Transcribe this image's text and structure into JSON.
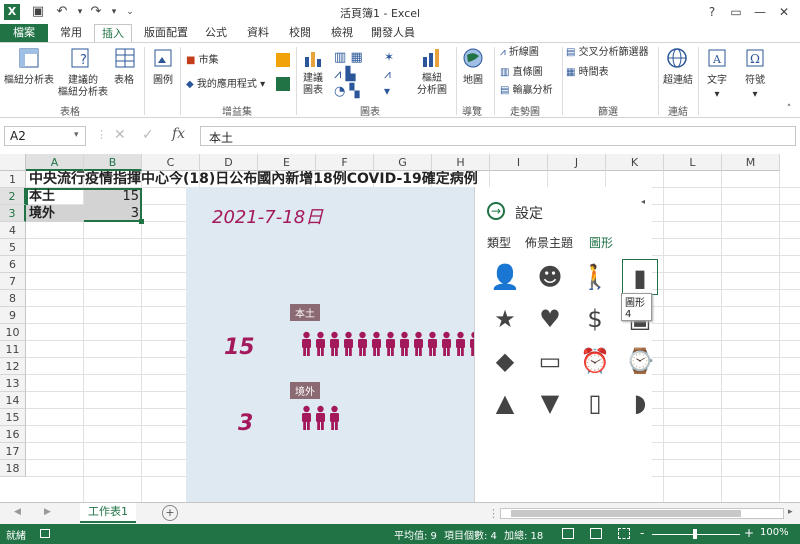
{
  "window": {
    "title": "活頁簿1 - Excel",
    "help": "?",
    "min": "—",
    "restore": "□",
    "close": "✕"
  },
  "tabs": [
    "檔案",
    "常用",
    "插入",
    "版面配置",
    "公式",
    "資料",
    "校閱",
    "檢視",
    "開發人員"
  ],
  "ribbon": {
    "pivot": "樞紐分析表",
    "rec_pivot_1": "建議的",
    "rec_pivot_2": "樞紐分析表",
    "table": "表格",
    "illustration": "圖例",
    "store": "市集",
    "myapps": "我的應用程式",
    "rec_chart_1": "建議",
    "rec_chart_2": "圖表",
    "pivot_chart_1": "樞紐",
    "pivot_chart_2": "分析圖",
    "map": "地圖",
    "line": "折線圖",
    "column": "直條圖",
    "winloss": "輸贏分析",
    "slicer": "交叉分析篩選器",
    "timeline": "時間表",
    "hyperlink": "超連結",
    "text": "文字",
    "symbol": "符號",
    "groups": {
      "tables": "表格",
      "addins": "增益集",
      "charts": "圖表",
      "tours": "導覽",
      "sparklines": "走勢圖",
      "filters": "篩選",
      "links": "連結"
    }
  },
  "formula": {
    "namebox": "A2",
    "fx": "fx",
    "value": "本土"
  },
  "columns": [
    "A",
    "B",
    "C",
    "D",
    "E",
    "F",
    "G",
    "H",
    "I",
    "J",
    "K",
    "L",
    "M"
  ],
  "rows": [
    "1",
    "2",
    "3",
    "4",
    "5",
    "6",
    "7",
    "8",
    "9",
    "10",
    "11",
    "12",
    "13",
    "14",
    "15",
    "16",
    "17",
    "18"
  ],
  "cells": {
    "title": "中央流行疫情指揮中心今(18)日公布國內新增18例COVID-19確定病例",
    "a2": "本土",
    "b2": "15",
    "a3": "境外",
    "b3": "3"
  },
  "chart": {
    "date": "2021-7-18日",
    "label1": "本土",
    "value1": "15",
    "label2": "境外",
    "value2": "3",
    "color": "#a3195b"
  },
  "panel": {
    "title": "設定",
    "tabs": [
      "類型",
      "佈景主題",
      "圖形"
    ],
    "tooltip": "圖形 4"
  },
  "sheet": {
    "tab": "工作表1",
    "add": "+"
  },
  "status": {
    "ready": "就緒",
    "avg": "平均值: 9",
    "count": "項目個數: 4",
    "sum": "加總: 18",
    "zoom": "100%",
    "minus": "-",
    "plus": "+"
  }
}
